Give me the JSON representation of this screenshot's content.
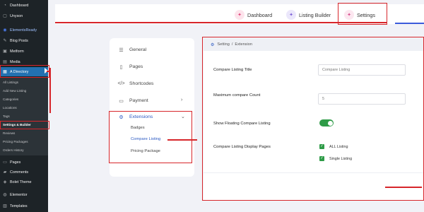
{
  "wp_sidebar": {
    "items": [
      {
        "label": "Dashboard",
        "icon": "dashboard-icon"
      },
      {
        "label": "Unyson",
        "icon": "unyson-icon"
      },
      {
        "label": "ElementsReady",
        "icon": "elementsready-icon"
      },
      {
        "label": "Blog Posts",
        "icon": "pin-icon"
      },
      {
        "label": "Metform",
        "icon": "metform-icon"
      },
      {
        "label": "Media",
        "icon": "media-icon"
      },
      {
        "label": "A Directory",
        "icon": "directory-icon"
      }
    ],
    "directory_submenu": [
      "All Listings",
      "Add New Listing",
      "Categories",
      "Locations",
      "Tags",
      "Settings & Builder",
      "Reviews",
      "Pricing Packages",
      "Orders History"
    ],
    "bottom_items": [
      {
        "label": "Pages",
        "icon": "pages-icon"
      },
      {
        "label": "Comments",
        "icon": "comments-icon"
      },
      {
        "label": "Bolet Theme",
        "icon": "theme-icon"
      },
      {
        "label": "Elementor",
        "icon": "elementor-icon"
      },
      {
        "label": "Templates",
        "icon": "templates-icon"
      }
    ]
  },
  "top_tabs": [
    {
      "label": "Dashboard",
      "icon": "dashboard-tab-icon",
      "icon_bg": "#fde4ec",
      "icon_color": "#e0457b"
    },
    {
      "label": "Listing Builder",
      "icon": "builder-tab-icon",
      "icon_bg": "#ebe7fb",
      "icon_color": "#7a5cd6"
    },
    {
      "label": "Settings",
      "icon": "settings-tab-icon",
      "icon_bg": "#fce7f0",
      "icon_color": "#d64a8b"
    }
  ],
  "settings_menu": {
    "items": [
      {
        "label": "General",
        "icon": "sliders-icon"
      },
      {
        "label": "Pages",
        "icon": "page-icon"
      },
      {
        "label": "Shortcodes",
        "icon": "code-icon"
      },
      {
        "label": "Payment",
        "icon": "payment-icon"
      },
      {
        "label": "Extensions",
        "icon": "gear-icon"
      }
    ],
    "extensions_submenu": [
      "Badges",
      "Compare Listing",
      "Pricing Package"
    ]
  },
  "panel": {
    "breadcrumb": [
      "Setting",
      "Extension"
    ],
    "fields": {
      "compare_title": {
        "label": "Compare Listing Title",
        "value": "Compare Listing"
      },
      "max_count": {
        "label": "Maximum compare Count",
        "value": "5"
      },
      "floating": {
        "label": "Show Floating Compare Listing",
        "enabled": true
      },
      "display_pages": {
        "label": "Compare Listing Display Pages",
        "options": [
          {
            "label": "ALL Listing",
            "checked": true
          },
          {
            "label": "Single Listing",
            "checked": true
          }
        ]
      }
    }
  },
  "colors": {
    "accent": "#2b59c3",
    "wp_active": "#2271b1",
    "annotation": "#d7262b",
    "toggle_on": "#2e9b47"
  }
}
